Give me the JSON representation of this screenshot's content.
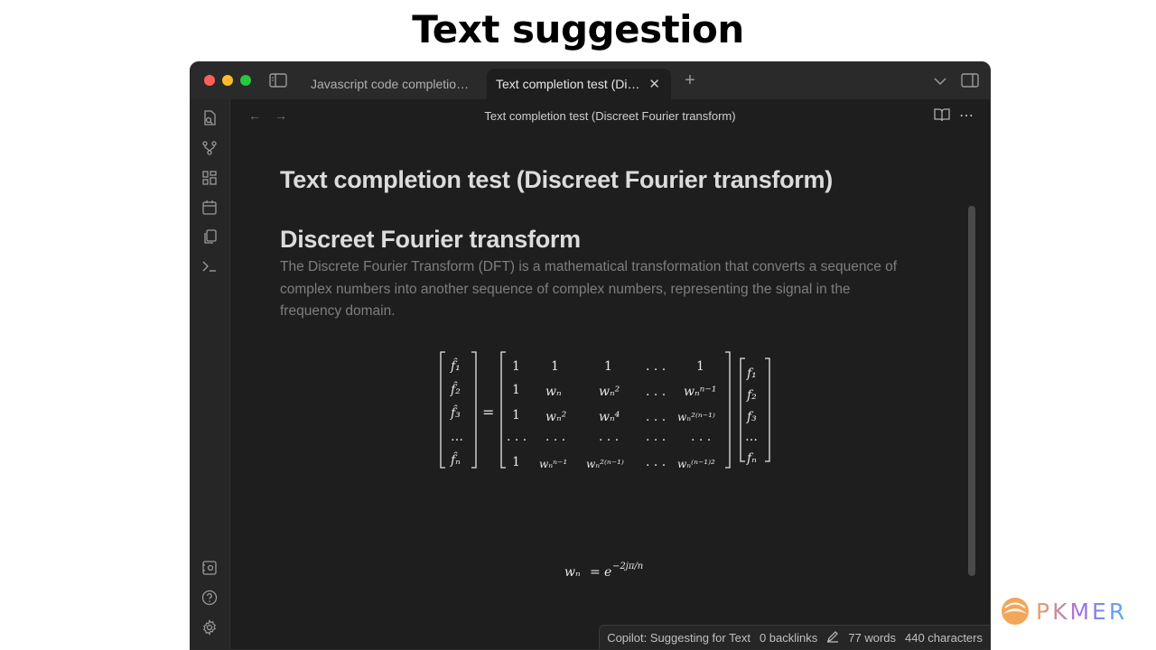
{
  "heading": "Text suggestion",
  "tabs": [
    {
      "label": "Javascript code completion ..."
    },
    {
      "label": "Text completion test (Dis..."
    }
  ],
  "nav": {
    "title": "Text completion test (Discreet Fourier transform)"
  },
  "document": {
    "title": "Text completion test (Discreet Fourier transform)",
    "heading": "Discreet Fourier transform",
    "paragraph": " The Discrete Fourier Transform (DFT) is a mathematical transformation that converts a sequence of complex numbers into another sequence of complex numbers, representing the signal in the frequency domain."
  },
  "status": {
    "copilot": "Copilot: Suggesting for Text",
    "backlinks": "0 backlinks",
    "words": "77 words",
    "characters": "440 characters"
  },
  "watermark": "PKMER",
  "icons": {
    "ribbon": [
      "file-search-icon",
      "git-branch-icon",
      "grid-icon",
      "calendar-icon",
      "copy-icon",
      "terminal-icon"
    ],
    "ribbon_bottom": [
      "vault-icon",
      "help-icon",
      "settings-icon"
    ]
  },
  "colors": {
    "background": "#1e1e1e",
    "titlebar": "#2a2a2a",
    "text_muted": "#7e7e7e"
  }
}
